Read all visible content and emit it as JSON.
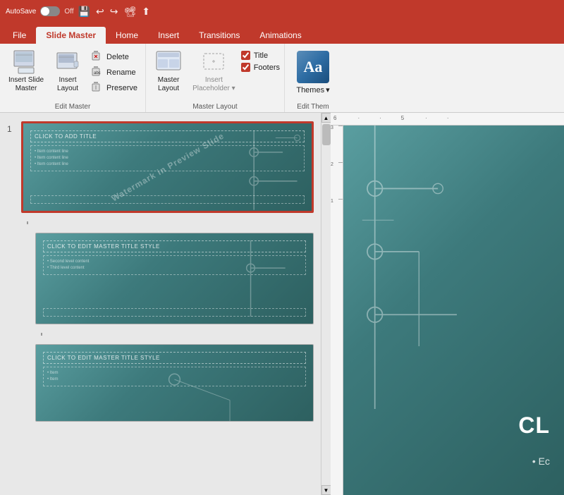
{
  "titlebar": {
    "autosave_label": "AutoSave",
    "autosave_state": "Off",
    "icons": [
      "💾",
      "↩",
      "↪",
      "📽",
      "⬆"
    ]
  },
  "tabs": [
    {
      "label": "File",
      "active": false
    },
    {
      "label": "Slide Master",
      "active": true
    },
    {
      "label": "Home",
      "active": false
    },
    {
      "label": "Insert",
      "active": false
    },
    {
      "label": "Transitions",
      "active": false
    },
    {
      "label": "Animations",
      "active": false
    }
  ],
  "ribbon": {
    "groups": [
      {
        "name": "Edit Master",
        "buttons": [
          {
            "id": "insert-slide-master",
            "label": "Insert Slide\nMaster",
            "icon": "📋"
          },
          {
            "id": "insert-layout",
            "label": "Insert\nLayout",
            "icon": "📄"
          }
        ],
        "small_buttons": [
          {
            "id": "delete",
            "label": "Delete",
            "icon": "🗑"
          },
          {
            "id": "rename",
            "label": "Rename",
            "icon": "✏"
          },
          {
            "id": "preserve",
            "label": "Preserve",
            "icon": "📌"
          }
        ]
      },
      {
        "name": "Master Layout",
        "buttons": [
          {
            "id": "master-layout",
            "label": "Master\nLayout",
            "icon": "⊞"
          }
        ],
        "placeholder_btn": {
          "id": "insert-placeholder",
          "label": "Insert\nPlaceholder",
          "icon": "⊡"
        },
        "checkboxes": [
          {
            "id": "title-check",
            "label": "Title",
            "checked": true
          },
          {
            "id": "footers-check",
            "label": "Footers",
            "checked": true
          }
        ]
      }
    ],
    "themes": {
      "label": "Themes",
      "sublabel": "Edit Them",
      "icon_text": "Aa"
    }
  },
  "slides": [
    {
      "number": "1",
      "selected": true,
      "title_text": "CLICK TO ADD TITLE",
      "body_lines": [
        "• Item content line",
        "• Item content line",
        "• Item content line"
      ],
      "diagonal_text": "Watermark in Preview Slide",
      "footer_text": ""
    },
    {
      "number": "",
      "selected": false,
      "title_text": "CLICK TO EDIT MASTER TITLE STYLE",
      "body_lines": [
        "• Second level",
        "• Third level"
      ],
      "diagonal_text": "",
      "footer_text": ""
    },
    {
      "number": "",
      "selected": false,
      "title_text": "CLICK TO EDIT MASTER TITLE STYLE",
      "body_lines": [
        "• Item",
        "• Item"
      ],
      "diagonal_text": "",
      "footer_text": ""
    }
  ],
  "ruler": {
    "h_marks": [
      "6",
      "·",
      "·",
      "5",
      "·",
      "·"
    ],
    "v_marks": [
      "3",
      "2",
      "1"
    ]
  },
  "editor": {
    "preview_title": "CL",
    "preview_bullet": "• Ec"
  }
}
